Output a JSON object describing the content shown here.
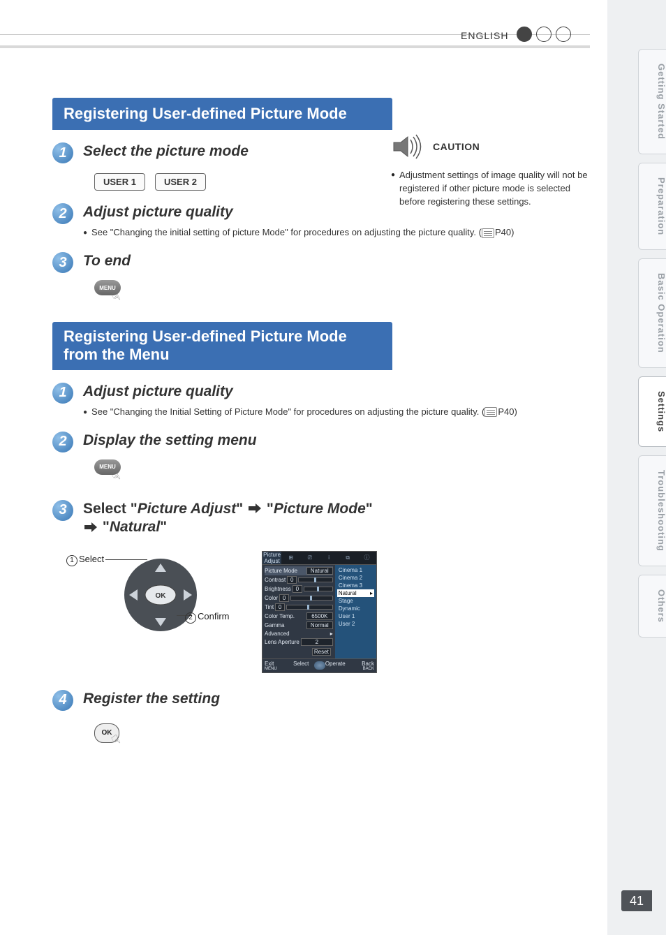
{
  "header": {
    "language": "ENGLISH"
  },
  "side_tabs": {
    "t1": "Getting Started",
    "t2": "Preparation",
    "t3": "Basic Operation",
    "t4": "Settings",
    "t5": "Troubleshooting",
    "t6": "Others",
    "active": "Settings"
  },
  "page_number": "41",
  "caution": {
    "label": "CAUTION",
    "text": "Adjustment settings of image quality will not be registered if other picture mode is selected before registering these settings."
  },
  "section1": {
    "title": "Registering User-defined Picture Mode",
    "step1": {
      "title": "Select the picture mode",
      "buttons": {
        "b1": "USER 1",
        "b2": "USER 2"
      }
    },
    "step2": {
      "title": "Adjust picture quality",
      "note": "See \"Changing the initial setting of picture Mode\" for procedures on adjusting the picture quality. (",
      "page_ref": "P40",
      "note_end": ")"
    },
    "step3": {
      "title": "To end",
      "button_label": "MENU"
    }
  },
  "section2": {
    "title": "Registering User-defined Picture Mode from the Menu",
    "step1": {
      "title": "Adjust picture quality",
      "note": "See \"Changing the Initial Setting of Picture Mode\" for procedures on adjusting the picture quality. (",
      "page_ref": "P40",
      "note_end": ")"
    },
    "step2": {
      "title": "Display the setting menu",
      "button_label": "MENU"
    },
    "step3": {
      "prefix": "Select ",
      "q1": "Picture Adjust",
      "q2": "Picture Mode",
      "q3": "Natural"
    },
    "diagram": {
      "select_label": "Select",
      "confirm_label": "Confirm",
      "ok_label": "OK"
    },
    "step4": {
      "title": "Register the setting",
      "ok_label": "OK"
    }
  },
  "osd": {
    "tab_label": "Picture Adjust",
    "rows": {
      "picture_mode": {
        "label": "Picture Mode",
        "value": "Natural"
      },
      "contrast": {
        "label": "Contrast",
        "value": "0"
      },
      "brightness": {
        "label": "Brightness",
        "value": "0"
      },
      "color": {
        "label": "Color",
        "value": "0"
      },
      "tint": {
        "label": "Tint",
        "value": "0"
      },
      "color_temp": {
        "label": "Color Temp.",
        "value": "6500K"
      },
      "gamma": {
        "label": "Gamma",
        "value": "Normal"
      },
      "advanced": {
        "label": "Advanced"
      },
      "lens_aperture": {
        "label": "Lens Aperture",
        "value": "2"
      },
      "reset": {
        "label": "Reset"
      }
    },
    "options": {
      "o1": "Cinema 1",
      "o2": "Cinema 2",
      "o3": "Cinema 3",
      "o4": "Natural",
      "o5": "Stage",
      "o6": "Dynamic",
      "o7": "User 1",
      "o8": "User 2"
    },
    "footer": {
      "exit": "Exit",
      "exit_sub": "MENU",
      "select": "Select",
      "operate": "Operate",
      "back": "Back",
      "back_sub": "BACK"
    }
  }
}
